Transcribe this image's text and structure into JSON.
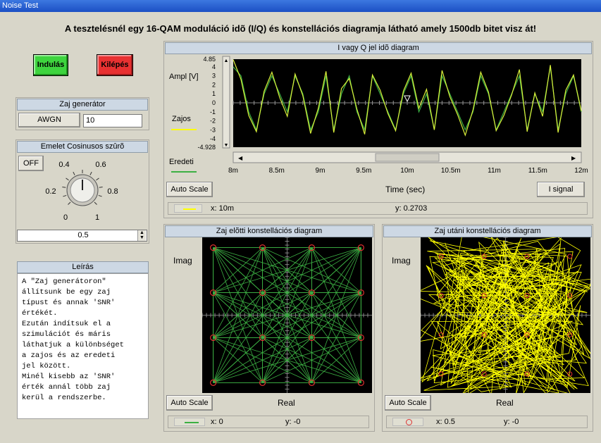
{
  "window": {
    "title": "Noise Test"
  },
  "headline": "A tesztelésnél egy 16-QAM moduláció idõ (I/Q) és konstellációs diagramja látható amely 1500db bitet visz át!",
  "buttons": {
    "start": "Indulás",
    "exit": "Kilépés"
  },
  "noise_generator": {
    "title": "Zaj generátor",
    "type": "AWGN",
    "snr": "10"
  },
  "filter": {
    "title": "Emelet Cosinusos szûrõ",
    "toggle": "OFF",
    "knob_labels": [
      "0",
      "0.2",
      "0.4",
      "0.6",
      "0.8",
      "1"
    ],
    "value": "0.5",
    "knob_level": 0.5
  },
  "description": {
    "title": "Leírás",
    "text": "A \"Zaj generátoron\"\nállítsunk be egy zaj\ntípust és annak 'SNR'\nértékét.\nEzután indítsuk el a\nszimulációt és máris\nláthatjuk a különbséget\na zajos és az eredeti\njel között.\nMinél kisebb az 'SNR'\nérték annál több zaj\nkerül a rendszerbe."
  },
  "time_plot": {
    "title": "I vagy Q jel idõ diagram",
    "ylabel": "Ampl [V]",
    "xlabel": "Time (sec)",
    "legend_noisy": "Zajos",
    "legend_original": "Eredeti",
    "autoscale": "Auto Scale",
    "signal_button": "I signal",
    "cursor_x": "x: 10m",
    "cursor_y": "y: 0.2703",
    "colors": {
      "noisy": "#ffff00",
      "original": "#3cb043",
      "bg": "#000000"
    }
  },
  "const_before": {
    "title": "Zaj elõtti konstellációs diagram",
    "ylabel": "Imag",
    "xlabel": "Real",
    "autoscale": "Auto Scale",
    "cursor_x": "x: 0",
    "cursor_y": "y: -0"
  },
  "const_after": {
    "title": "Zaj utáni konstellációs diagram",
    "ylabel": "Imag",
    "xlabel": "Real",
    "autoscale": "Auto Scale",
    "cursor_x": "x: 0.5",
    "cursor_y": "y: -0"
  },
  "chart_data": [
    {
      "type": "line",
      "title": "I vagy Q jel idõ diagram",
      "xlabel": "Time (sec)",
      "ylabel": "Ampl [V]",
      "xlim": [
        0.008,
        0.012
      ],
      "ylim": [
        -4.928,
        4.85
      ],
      "x_tick_labels": [
        "8m",
        "8.5m",
        "9m",
        "9.5m",
        "10m",
        "10.5m",
        "11m",
        "11.5m",
        "12m"
      ],
      "y_tick_labels": [
        "4.85",
        "4",
        "3",
        "2",
        "1",
        "0",
        "-1",
        "-2",
        "-3",
        "-4",
        "-4.928"
      ],
      "series": [
        {
          "name": "Eredeti",
          "values": [
            4,
            3,
            -1,
            -3,
            1,
            3,
            1,
            -1,
            3,
            1,
            -3,
            -1,
            3,
            -3,
            1,
            3,
            -1,
            -3,
            3,
            1,
            -1,
            -3,
            1,
            3,
            -1,
            1,
            -3,
            3,
            1,
            -1,
            -3,
            -1,
            3,
            1,
            -3,
            -1,
            1,
            3,
            -3,
            1,
            -1,
            4,
            -3,
            1,
            3,
            -1
          ]
        },
        {
          "name": "Zajos",
          "values": [
            4.8,
            2.6,
            -1.4,
            -3.2,
            1.3,
            3.4,
            0.6,
            -1.5,
            3.2,
            0.8,
            -3.4,
            -0.6,
            3.5,
            -3.3,
            1.6,
            2.7,
            -0.7,
            -3.5,
            3.1,
            1.4,
            -1.2,
            -3.1,
            1.3,
            3.3,
            -0.6,
            1.5,
            -3.0,
            3.6,
            0.7,
            -1.3,
            -3.6,
            -0.8,
            3.4,
            1.2,
            -3.1,
            -1.4,
            0.9,
            3.7,
            -3.2,
            1.1,
            -1.5,
            4.2,
            -3.3,
            1.4,
            3.1,
            -0.9
          ]
        }
      ]
    },
    {
      "type": "scatter",
      "title": "Zaj elõtti konstellációs diagram",
      "xlabel": "Real",
      "ylabel": "Imag",
      "xlim": [
        -4,
        4
      ],
      "ylim": [
        -4,
        4
      ],
      "series": [
        {
          "name": "Eredeti",
          "points": [
            [
              -3,
              3
            ],
            [
              -1,
              3
            ],
            [
              1,
              3
            ],
            [
              3,
              3
            ],
            [
              -3,
              1
            ],
            [
              -1,
              1
            ],
            [
              1,
              1
            ],
            [
              3,
              1
            ],
            [
              -3,
              -1
            ],
            [
              -1,
              -1
            ],
            [
              1,
              -1
            ],
            [
              3,
              -1
            ],
            [
              -3,
              -3
            ],
            [
              -1,
              -3
            ],
            [
              1,
              -3
            ],
            [
              3,
              -3
            ]
          ]
        }
      ]
    },
    {
      "type": "scatter",
      "title": "Zaj utáni konstellációs diagram",
      "xlabel": "Real",
      "ylabel": "Imag",
      "xlim": [
        -4,
        4
      ],
      "ylim": [
        -4,
        4
      ],
      "series": [
        {
          "name": "Zajos",
          "noise_spread": 1.1,
          "count": 300
        }
      ]
    }
  ]
}
